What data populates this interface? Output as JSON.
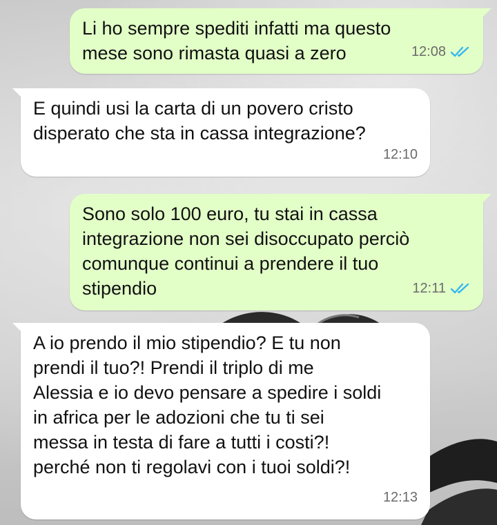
{
  "colors": {
    "outgoing_bubble": "#e2ffc7",
    "incoming_bubble": "#ffffff",
    "read_ticks": "#34b7f1",
    "timestamp": "#6b6b6b"
  },
  "messages": [
    {
      "direction": "outgoing",
      "text": "Li ho sempre spediti infatti ma questo\nmese sono rimasta quasi a zero",
      "time": "12:08",
      "status_icon": "double-check-read-icon"
    },
    {
      "direction": "incoming",
      "text": "E quindi usi la carta di un povero cristo\ndisperato che sta in cassa integrazione?",
      "time": "12:10"
    },
    {
      "direction": "outgoing",
      "text": "Sono solo 100 euro, tu stai in cassa\nintegrazione non sei disoccupato perciò\ncomunque continui a prendere il tuo\nstipendio",
      "time": "12:11",
      "status_icon": "double-check-read-icon"
    },
    {
      "direction": "incoming",
      "text": "A io prendo il mio stipendio? E tu non\nprendi il tuo?! Prendi il triplo  di me\nAlessia e io devo pensare a spedire i soldi\nin africa per le adozioni che tu ti sei\nmessa in testa di fare a tutti i costi?!\nperché non ti regolavi con i tuoi soldi?!",
      "time": "12:13"
    }
  ]
}
